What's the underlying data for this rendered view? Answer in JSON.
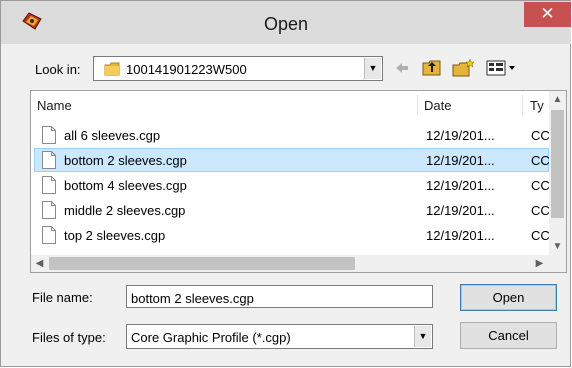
{
  "window": {
    "title": "Open",
    "close_glyph": "✕"
  },
  "lookin": {
    "label": "Look in:",
    "value": "100141901223W500",
    "icons": [
      "folder-icon",
      "back-arrow-icon",
      "up-folder-icon",
      "new-folder-icon",
      "view-menu-icon"
    ]
  },
  "filelist": {
    "columns": {
      "name": "Name",
      "date": "Date",
      "type": "Ty"
    },
    "rows": [
      {
        "name": "all 6 sleeves.cgp",
        "date": "12/19/201...",
        "type": "CC",
        "selected": false
      },
      {
        "name": "bottom 2 sleeves.cgp",
        "date": "12/19/201...",
        "type": "CC",
        "selected": true
      },
      {
        "name": "bottom 4 sleeves.cgp",
        "date": "12/19/201...",
        "type": "CC",
        "selected": false
      },
      {
        "name": "middle 2 sleeves.cgp",
        "date": "12/19/201...",
        "type": "CC",
        "selected": false
      },
      {
        "name": "top 2 sleeves.cgp",
        "date": "12/19/201...",
        "type": "CC",
        "selected": false
      }
    ]
  },
  "filename": {
    "label": "File name:",
    "value": "bottom 2 sleeves.cgp"
  },
  "filetype": {
    "label": "Files of type:",
    "value": "Core Graphic Profile (*.cgp)"
  },
  "buttons": {
    "open": "Open",
    "cancel": "Cancel"
  },
  "colors": {
    "selection": "#cce8ff",
    "close": "#c75050",
    "titlebar": "#dcdcdc"
  }
}
